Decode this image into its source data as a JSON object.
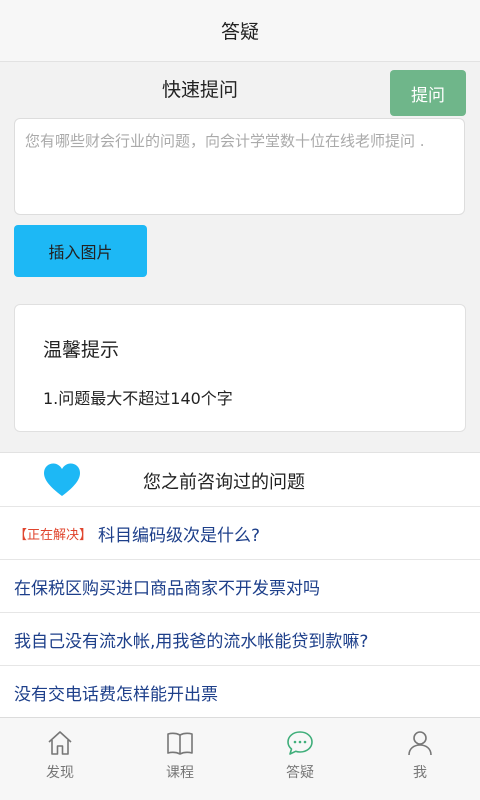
{
  "header": {
    "title": "答疑"
  },
  "ask": {
    "title": "快速提问",
    "button_label": "提问",
    "placeholder": "您有哪些财会行业的问题，向会计学堂数十位在线老师提问 .",
    "insert_image_label": "插入图片"
  },
  "tips": {
    "title": "温馨提示",
    "text": "1.问题最大不超过140个字"
  },
  "history": {
    "title": "您之前咨询过的问题",
    "items": [
      {
        "status": "【正在解决】",
        "text": "科目编码级次是什么?"
      },
      {
        "status": "",
        "text": "在保税区购买进口商品商家不开发票对吗"
      },
      {
        "status": "",
        "text": "我自己没有流水帐,用我爸的流水帐能贷到款嘛?"
      },
      {
        "status": "",
        "text": "没有交电话费怎样能开出票"
      }
    ]
  },
  "tabs": [
    {
      "label": "发现",
      "icon": "home-icon"
    },
    {
      "label": "课程",
      "icon": "book-icon"
    },
    {
      "label": "答疑",
      "icon": "chat-icon",
      "active": true
    },
    {
      "label": "我",
      "icon": "user-icon"
    }
  ],
  "colors": {
    "ask_button": "#6fb68a",
    "insert_button": "#1db8f5",
    "heart": "#1db8f5",
    "status": "#e0452e",
    "link": "#1d3f8a",
    "active_tab_icon": "#3fae7a"
  }
}
